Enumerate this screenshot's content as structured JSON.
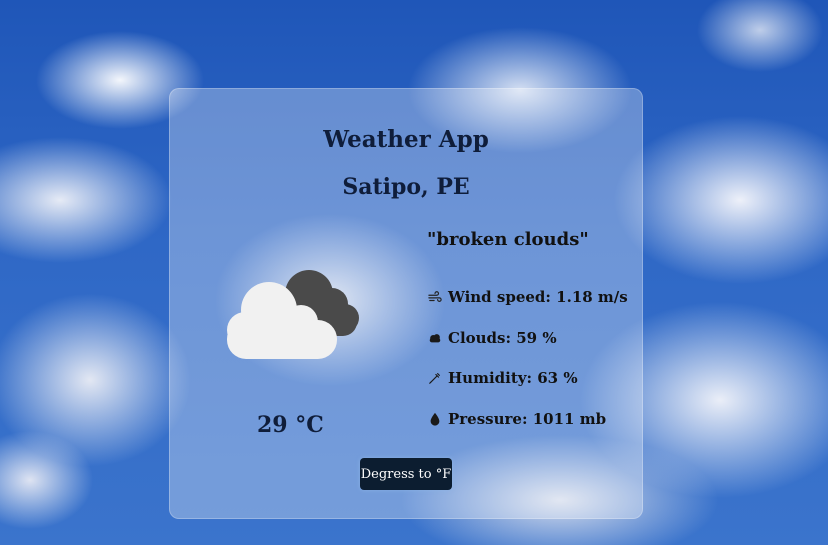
{
  "app": {
    "title": "Weather App"
  },
  "location": {
    "label": "Satipo, PE"
  },
  "weather": {
    "description": "\"broken clouds\"",
    "icon": "broken-clouds-icon",
    "temperature": "29 °C"
  },
  "details": {
    "wind": {
      "label": "Wind speed: 1.18 m/s",
      "icon": "wind-icon"
    },
    "clouds": {
      "label": "Clouds: 59 %",
      "icon": "cloud-icon"
    },
    "humidity": {
      "label": "Humidity: 63 %",
      "icon": "dropper-icon"
    },
    "pressure": {
      "label": "Pressure: 1011 mb",
      "icon": "droplet-icon"
    }
  },
  "controls": {
    "toggle_units_label": "Degress to °F"
  },
  "colors": {
    "card_bg": "rgba(255,255,255,0.30)",
    "heading_text": "#0f1d3a",
    "button_bg": "#0c1d30",
    "cloud_front": "#f1f1f1",
    "cloud_back": "#4a4a4a"
  }
}
